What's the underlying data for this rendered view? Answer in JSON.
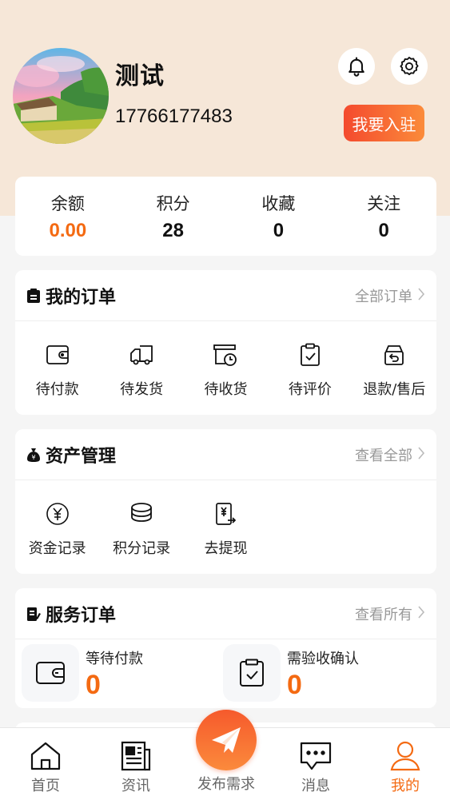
{
  "profile": {
    "username": "测试",
    "phone": "17766177483",
    "join_label": "我要入驻"
  },
  "stats": [
    {
      "label": "余额",
      "value": "0.00"
    },
    {
      "label": "积分",
      "value": "28"
    },
    {
      "label": "收藏",
      "value": "0"
    },
    {
      "label": "关注",
      "value": "0"
    }
  ],
  "orders": {
    "title": "我的订单",
    "more": "全部订单",
    "items": [
      {
        "label": "待付款",
        "icon": "wallet-icon"
      },
      {
        "label": "待发货",
        "icon": "truck-icon"
      },
      {
        "label": "待收货",
        "icon": "receive-icon"
      },
      {
        "label": "待评价",
        "icon": "review-icon"
      },
      {
        "label": "退款/售后",
        "icon": "refund-icon"
      }
    ]
  },
  "assets": {
    "title": "资产管理",
    "more": "查看全部",
    "items": [
      {
        "label": "资金记录",
        "icon": "yuan-coin-icon"
      },
      {
        "label": "积分记录",
        "icon": "coins-stack-icon"
      },
      {
        "label": "去提现",
        "icon": "withdraw-icon"
      }
    ]
  },
  "services": {
    "title": "服务订单",
    "more": "查看所有",
    "items": [
      {
        "label": "等待付款",
        "count": "0"
      },
      {
        "label": "需验收确认",
        "count": "0"
      }
    ]
  },
  "tabbar": {
    "home": "首页",
    "news": "资讯",
    "publish": "发布需求",
    "messages": "消息",
    "mine": "我的"
  },
  "colors": {
    "accent": "#f46a12",
    "header_bg": "#f6e7d8",
    "join_gradient_start": "#f44a2e",
    "join_gradient_end": "#fb8b3a"
  }
}
